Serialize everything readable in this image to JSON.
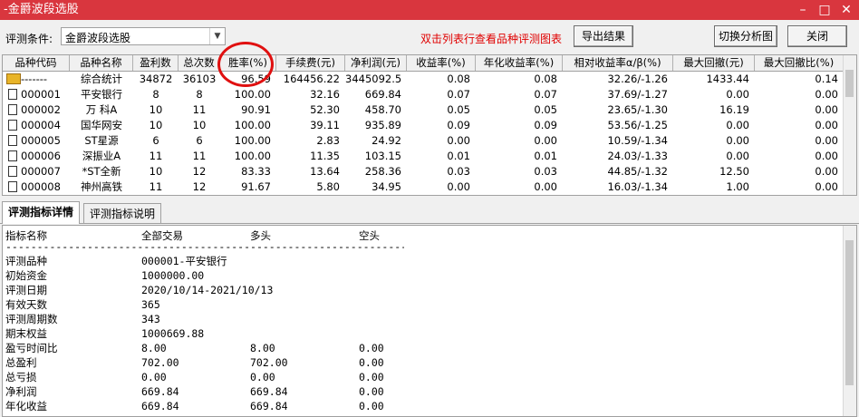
{
  "window": {
    "title": "-金爵波段选股"
  },
  "toolbar": {
    "condition_label": "评测条件:",
    "condition_value": "金爵波段选股",
    "hint": "双击列表行查看品种评测图表",
    "export_label": "导出结果",
    "switch_label": "切换分析图",
    "close_label": "关闭"
  },
  "table": {
    "columns": [
      "品种代码",
      "品种名称",
      "盈利数",
      "总次数",
      "胜率(%)",
      "手续费(元)",
      "净利润(元)",
      "收益率(%)",
      "年化收益率(%)",
      "相对收益率α/β(%)",
      "最大回撤(元)",
      "最大回撤比(%)"
    ],
    "rows": [
      [
        "-------",
        "综合统计",
        "34872",
        "36103",
        "96.59",
        "164456.22",
        "3445092.52",
        "0.08",
        "0.08",
        "32.26/-1.26",
        "1433.44",
        "0.14"
      ],
      [
        "000001",
        "平安银行",
        "8",
        "8",
        "100.00",
        "32.16",
        "669.84",
        "0.07",
        "0.07",
        "37.69/-1.27",
        "0.00",
        "0.00"
      ],
      [
        "000002",
        "万 科A",
        "10",
        "11",
        "90.91",
        "52.30",
        "458.70",
        "0.05",
        "0.05",
        "23.65/-1.30",
        "16.19",
        "0.00"
      ],
      [
        "000004",
        "国华网安",
        "10",
        "10",
        "100.00",
        "39.11",
        "935.89",
        "0.09",
        "0.09",
        "53.56/-1.25",
        "0.00",
        "0.00"
      ],
      [
        "000005",
        "ST星源",
        "6",
        "6",
        "100.00",
        "2.83",
        "24.92",
        "0.00",
        "0.00",
        "10.59/-1.34",
        "0.00",
        "0.00"
      ],
      [
        "000006",
        "深振业A",
        "11",
        "11",
        "100.00",
        "11.35",
        "103.15",
        "0.01",
        "0.01",
        "24.03/-1.33",
        "0.00",
        "0.00"
      ],
      [
        "000007",
        "*ST全新",
        "10",
        "12",
        "83.33",
        "13.64",
        "258.36",
        "0.03",
        "0.03",
        "44.85/-1.32",
        "12.50",
        "0.00"
      ],
      [
        "000008",
        "神州高铁",
        "11",
        "12",
        "91.67",
        "5.80",
        "34.95",
        "0.00",
        "0.00",
        "16.03/-1.34",
        "1.00",
        "0.00"
      ]
    ]
  },
  "tabs": [
    "评测指标详情",
    "评测指标说明"
  ],
  "detail": {
    "headers": [
      "指标名称",
      "全部交易",
      "多头",
      "空头"
    ],
    "separator": "------------------------------------------------------------------------------------------------------------------------",
    "info": [
      [
        "评测品种",
        "000001-平安银行"
      ],
      [
        "初始资金",
        "1000000.00"
      ],
      [
        "评测日期",
        "2020/10/14-2021/10/13"
      ],
      [
        "有效天数",
        "365"
      ],
      [
        "评测周期数",
        "343"
      ],
      [
        "期末权益",
        "1000669.88"
      ]
    ],
    "metrics": [
      [
        "盈亏时间比",
        "8.00",
        "8.00",
        "0.00"
      ],
      [
        "总盈利",
        "702.00",
        "702.00",
        "0.00"
      ],
      [
        "总亏损",
        "0.00",
        "0.00",
        "0.00"
      ],
      [
        "净利润",
        "669.84",
        "669.84",
        "0.00"
      ],
      [
        "年化收益",
        "669.84",
        "669.84",
        "0.00"
      ]
    ]
  }
}
